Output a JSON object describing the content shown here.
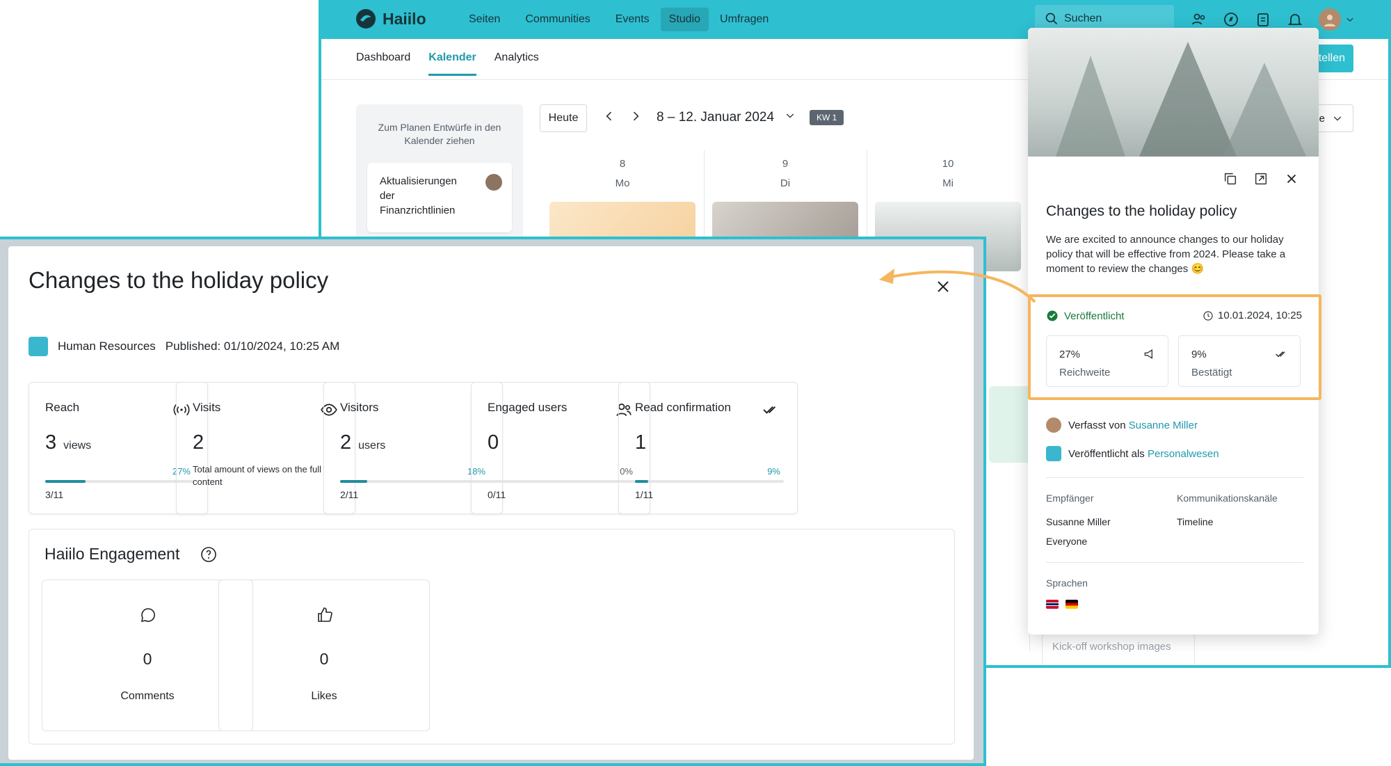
{
  "app": {
    "name": "Haiilo",
    "brand_color": "#2ebfd0",
    "accent": "#1f9aac",
    "highlight": "#f5b65e"
  },
  "topnav": {
    "items": [
      "Seiten",
      "Communities",
      "Events",
      "Studio",
      "Umfragen"
    ],
    "active": "Studio",
    "search_placeholder": "Suchen",
    "icons": [
      "people-icon",
      "compass-icon",
      "clipboard-icon",
      "bell-icon",
      "avatar"
    ]
  },
  "tabs": {
    "items": [
      "Dashboard",
      "Kalender",
      "Analytics"
    ],
    "active": "Kalender"
  },
  "calendar": {
    "drafts_hint": "Zum Planen Entwürfe in den Kalender ziehen",
    "draft_title": "Aktualisierungen der Finanzrichtlinien",
    "today_label": "Heute",
    "range": "8 – 12. Januar 2024",
    "week_badge": "KW 1",
    "days": [
      {
        "num": "8",
        "name": "Mo"
      },
      {
        "num": "9",
        "name": "Di"
      },
      {
        "num": "10",
        "name": "Mi"
      }
    ],
    "create_button": "tellen",
    "select_label": "e",
    "kickoff_title": "Kick-off workshop images"
  },
  "panel": {
    "title": "Changes to the holiday policy",
    "description": "We are excited to announce changes to our holiday policy that will be effective from 2024. Please take a moment to review the changes 😊",
    "status": "Veröffentlicht",
    "date": "10.01.2024, 10:25",
    "reach": {
      "value": "27%",
      "label": "Reichweite"
    },
    "confirmed": {
      "value": "9%",
      "label": "Bestätigt"
    },
    "author_prefix": "Verfasst von",
    "author": "Susanne Miller",
    "published_as_prefix": "Veröffentlicht als",
    "published_as": "Personalwesen",
    "recipients_label": "Empfänger",
    "recipients": [
      "Susanne Miller",
      "Everyone"
    ],
    "channels_label": "Kommunikationskanäle",
    "channels": [
      "Timeline"
    ],
    "languages_label": "Sprachen",
    "languages": [
      "uk-flag",
      "de-flag"
    ]
  },
  "modal": {
    "title": "Changes to the holiday policy",
    "sender": "Human Resources",
    "published": "Published: 01/10/2024, 10:25 AM",
    "cards": [
      {
        "title": "Reach",
        "icon": "broadcast-icon",
        "value": "3",
        "unit": "views",
        "percent": "27%",
        "progress": 0.27,
        "fraction": "3/11"
      },
      {
        "title": "Visits",
        "icon": "eye-icon",
        "value": "2",
        "desc": "Total amount of views on the full content"
      },
      {
        "title": "Visitors",
        "icon": "",
        "value": "2",
        "unit": "users",
        "percent": "18%",
        "progress": 0.18,
        "fraction": "2/11"
      },
      {
        "title": "Engaged users",
        "icon": "users-icon",
        "value": "0",
        "percent": "0%",
        "progress": 0,
        "fraction": "0/11"
      },
      {
        "title": "Read confirmation",
        "icon": "double-check-icon",
        "value": "1",
        "percent": "9%",
        "progress": 0.09,
        "fraction": "1/11"
      }
    ],
    "engagement": {
      "title": "Haiilo Engagement",
      "items": [
        {
          "icon": "comment-icon",
          "value": "0",
          "label": "Comments"
        },
        {
          "icon": "thumbs-up-icon",
          "value": "0",
          "label": "Likes"
        }
      ]
    }
  }
}
